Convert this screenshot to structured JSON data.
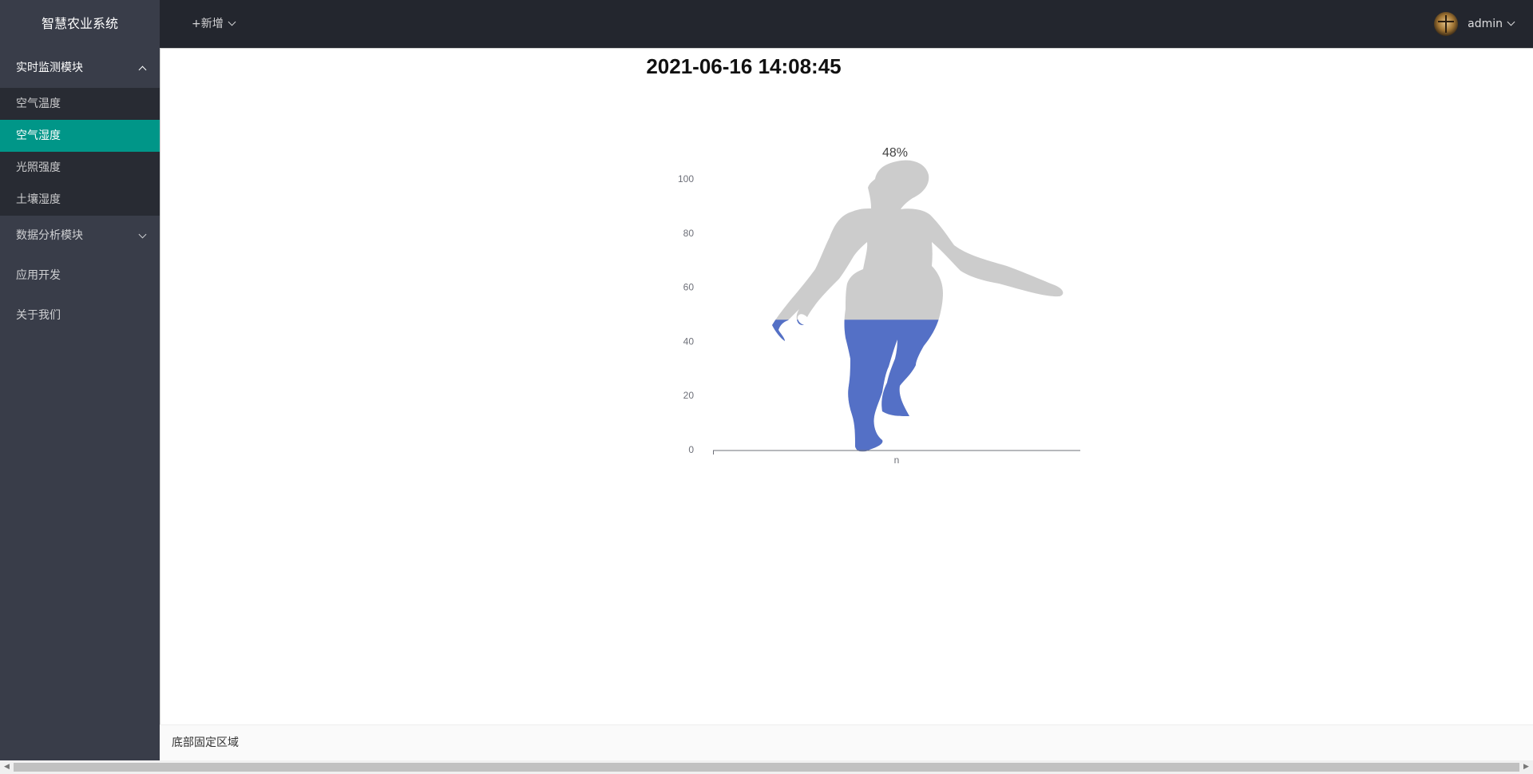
{
  "header": {
    "app_title": "智慧农业系统",
    "add_menu_label": "+新增",
    "user_name": "admin"
  },
  "sidebar": {
    "groups": [
      {
        "label": "实时监测模块",
        "expanded": true,
        "items": [
          {
            "label": "空气温度",
            "active": false
          },
          {
            "label": "空气湿度",
            "active": true
          },
          {
            "label": "光照强度",
            "active": false
          },
          {
            "label": "土壤湿度",
            "active": false
          }
        ]
      },
      {
        "label": "数据分析模块",
        "expanded": false
      },
      {
        "label": "应用开发"
      },
      {
        "label": "关于我们"
      }
    ]
  },
  "main": {
    "timestamp": "2021-06-16 14:08:45"
  },
  "footer": {
    "text": "底部固定区域"
  },
  "colors": {
    "accent": "#009688",
    "fill": "#5470c6",
    "empty": "#cccccc",
    "header": "#23262e",
    "sidebar": "#393d49"
  },
  "icons": {
    "add_menu": "chevron-down-icon",
    "user_menu": "chevron-down-icon",
    "group_open": "chevron-up-icon",
    "group_closed": "chevron-down-icon",
    "avatar": "user-avatar-image"
  },
  "chart_data": {
    "type": "bar",
    "style": "pictorial-silhouette",
    "categories": [
      "n"
    ],
    "values": [
      48
    ],
    "value_label": "48%",
    "ylim": [
      0,
      100
    ],
    "yticks": [
      0,
      20,
      40,
      60,
      80,
      100
    ],
    "grid": false,
    "legend": false
  }
}
